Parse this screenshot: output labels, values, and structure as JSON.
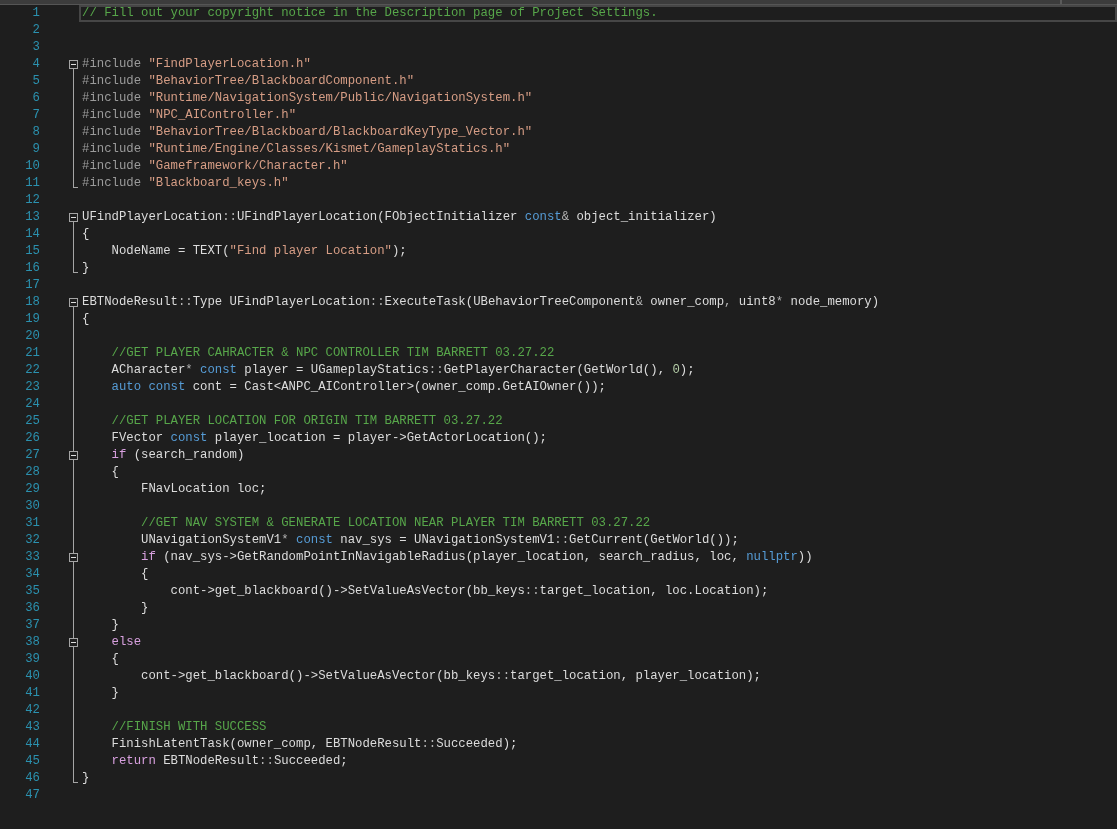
{
  "editor": {
    "lines": [
      {
        "number": "1",
        "current": true,
        "collapsible": false,
        "kind": "plain",
        "tokens": [
          {
            "kind": "comment",
            "text": "// Fill out your copyright notice in the Description page of Project Settings."
          }
        ]
      },
      {
        "number": "2",
        "current": false,
        "collapsible": false,
        "kind": "plain"
      },
      {
        "number": "3",
        "current": false,
        "collapsible": false,
        "kind": "plain"
      },
      {
        "number": "4",
        "current": false,
        "collapsible": true,
        "kind": "fold-start",
        "tokens": [
          {
            "kind": "directive",
            "text": "#include"
          },
          {
            "kind": "string",
            "text": " \"FindPlayerLocation.h\""
          }
        ]
      },
      {
        "number": "5",
        "current": false,
        "collapsible": false,
        "kind": "fold-body",
        "tokens": [
          {
            "kind": "directive",
            "text": "#include"
          },
          {
            "kind": "string",
            "text": " \"BehaviorTree/BlackboardComponent.h\""
          }
        ]
      },
      {
        "number": "6",
        "current": false,
        "collapsible": false,
        "kind": "fold-body",
        "tokens": [
          {
            "kind": "directive",
            "text": "#include"
          },
          {
            "kind": "string",
            "text": " \"Runtime/NavigationSystem/Public/NavigationSystem.h\""
          }
        ]
      },
      {
        "number": "7",
        "current": false,
        "collapsible": false,
        "kind": "fold-body",
        "tokens": [
          {
            "kind": "directive",
            "text": "#include"
          },
          {
            "kind": "string",
            "text": " \"NPC_AIController.h\""
          }
        ]
      },
      {
        "number": "8",
        "current": false,
        "collapsible": false,
        "kind": "fold-body",
        "tokens": [
          {
            "kind": "directive",
            "text": "#include"
          },
          {
            "kind": "string",
            "text": " \"BehaviorTree/Blackboard/BlackboardKeyType_Vector.h\""
          }
        ]
      },
      {
        "number": "9",
        "current": false,
        "collapsible": false,
        "kind": "fold-body",
        "tokens": [
          {
            "kind": "directive",
            "text": "#include"
          },
          {
            "kind": "string",
            "text": " \"Runtime/Engine/Classes/Kismet/GameplayStatics.h\""
          }
        ]
      },
      {
        "number": "10",
        "current": false,
        "collapsible": false,
        "kind": "fold-body",
        "tokens": [
          {
            "kind": "directive",
            "text": "#include"
          },
          {
            "kind": "string",
            "text": " \"Gameframework/Character.h\""
          }
        ]
      },
      {
        "number": "11",
        "current": false,
        "collapsible": false,
        "kind": "fold-end",
        "tokens": [
          {
            "kind": "directive",
            "text": "#include"
          },
          {
            "kind": "string",
            "text": " \"Blackboard_keys.h\""
          }
        ]
      },
      {
        "number": "12",
        "current": false,
        "collapsible": false,
        "kind": "plain"
      },
      {
        "number": "13",
        "current": false,
        "collapsible": true,
        "kind": "fold-start",
        "tokens": [
          {
            "kind": "plain",
            "text": "UFindPlayerLocation"
          },
          {
            "kind": "operator",
            "text": "::"
          },
          {
            "kind": "plain",
            "text": "UFindPlayerLocation(FObjectInitializer "
          },
          {
            "kind": "keyword",
            "text": "const"
          },
          {
            "kind": "operator",
            "text": "&"
          },
          {
            "kind": "plain",
            "text": " object_initializer)"
          }
        ]
      },
      {
        "number": "14",
        "current": false,
        "collapsible": false,
        "kind": "fold-body",
        "tokens": [
          {
            "kind": "plain",
            "text": "{"
          }
        ]
      },
      {
        "number": "15",
        "current": false,
        "collapsible": false,
        "kind": "fold-body",
        "tokens": [
          {
            "kind": "plain",
            "text": "    NodeName = TEXT("
          },
          {
            "kind": "string",
            "text": "\"Find player Location\""
          },
          {
            "kind": "plain",
            "text": ");"
          }
        ]
      },
      {
        "number": "16",
        "current": false,
        "collapsible": false,
        "kind": "fold-end",
        "tokens": [
          {
            "kind": "plain",
            "text": "}"
          }
        ]
      },
      {
        "number": "17",
        "current": false,
        "collapsible": false,
        "kind": "plain"
      },
      {
        "number": "18",
        "current": false,
        "collapsible": true,
        "kind": "fold-start",
        "tokens": [
          {
            "kind": "plain",
            "text": "EBTNodeResult"
          },
          {
            "kind": "operator",
            "text": "::"
          },
          {
            "kind": "plain",
            "text": "Type UFindPlayerLocation"
          },
          {
            "kind": "operator",
            "text": "::"
          },
          {
            "kind": "plain",
            "text": "ExecuteTask(UBehaviorTreeComponent"
          },
          {
            "kind": "operator",
            "text": "&"
          },
          {
            "kind": "plain",
            "text": " owner_comp"
          },
          {
            "kind": "operator",
            "text": ","
          },
          {
            "kind": "plain",
            "text": " uint8"
          },
          {
            "kind": "operator",
            "text": "*"
          },
          {
            "kind": "plain",
            "text": " node_memory)"
          }
        ]
      },
      {
        "number": "19",
        "current": false,
        "collapsible": false,
        "kind": "fold-body",
        "tokens": [
          {
            "kind": "plain",
            "text": "{"
          }
        ]
      },
      {
        "number": "20",
        "current": false,
        "collapsible": false,
        "kind": "fold-body"
      },
      {
        "number": "21",
        "current": false,
        "collapsible": false,
        "kind": "fold-body",
        "tokens": [
          {
            "kind": "comment",
            "text": "    //GET PLAYER CAHRACTER & NPC CONTROLLER TIM BARRETT 03.27.22"
          }
        ]
      },
      {
        "number": "22",
        "current": false,
        "collapsible": false,
        "kind": "fold-body",
        "tokens": [
          {
            "kind": "plain",
            "text": "    ACharacter"
          },
          {
            "kind": "operator",
            "text": "*"
          },
          {
            "kind": "keyword",
            "text": " const"
          },
          {
            "kind": "plain",
            "text": " player = UGameplayStatics"
          },
          {
            "kind": "operator",
            "text": "::"
          },
          {
            "kind": "plain",
            "text": "GetPlayerCharacter(GetWorld(), "
          },
          {
            "kind": "number",
            "text": "0"
          },
          {
            "kind": "plain",
            "text": ");"
          }
        ]
      },
      {
        "number": "23",
        "current": false,
        "collapsible": false,
        "kind": "fold-body",
        "tokens": [
          {
            "kind": "keyword",
            "text": "    auto const"
          },
          {
            "kind": "plain",
            "text": " cont = Cast<ANPC_AIController>(owner_comp.GetAIOwner());"
          }
        ]
      },
      {
        "number": "24",
        "current": false,
        "collapsible": false,
        "kind": "fold-body"
      },
      {
        "number": "25",
        "current": false,
        "collapsible": false,
        "kind": "fold-body",
        "tokens": [
          {
            "kind": "comment",
            "text": "    //GET PLAYER LOCATION FOR ORIGIN TIM BARRETT 03.27.22"
          }
        ]
      },
      {
        "number": "26",
        "current": false,
        "collapsible": false,
        "kind": "fold-body",
        "tokens": [
          {
            "kind": "plain",
            "text": "    FVector "
          },
          {
            "kind": "keyword",
            "text": "const"
          },
          {
            "kind": "plain",
            "text": " player_location = player->GetActorLocation();"
          }
        ]
      },
      {
        "number": "27",
        "current": false,
        "collapsible": true,
        "kind": "fold-body",
        "tokens": [
          {
            "kind": "control",
            "text": "    if"
          },
          {
            "kind": "plain",
            "text": " (search_random)"
          }
        ]
      },
      {
        "number": "28",
        "current": false,
        "collapsible": false,
        "kind": "fold-body",
        "tokens": [
          {
            "kind": "plain",
            "text": "    {"
          }
        ]
      },
      {
        "number": "29",
        "current": false,
        "collapsible": false,
        "kind": "fold-body",
        "tokens": [
          {
            "kind": "plain",
            "text": "        FNavLocation loc;"
          }
        ]
      },
      {
        "number": "30",
        "current": false,
        "collapsible": false,
        "kind": "fold-body"
      },
      {
        "number": "31",
        "current": false,
        "collapsible": false,
        "kind": "fold-body",
        "tokens": [
          {
            "kind": "comment",
            "text": "        //GET NAV SYSTEM & GENERATE LOCATION NEAR PLAYER TIM BARRETT 03.27.22"
          }
        ]
      },
      {
        "number": "32",
        "current": false,
        "collapsible": false,
        "kind": "fold-body",
        "tokens": [
          {
            "kind": "plain",
            "text": "        UNavigationSystemV1"
          },
          {
            "kind": "operator",
            "text": "*"
          },
          {
            "kind": "keyword",
            "text": " const"
          },
          {
            "kind": "plain",
            "text": " nav_sys = UNavigationSystemV1"
          },
          {
            "kind": "operator",
            "text": "::"
          },
          {
            "kind": "plain",
            "text": "GetCurrent(GetWorld());"
          }
        ]
      },
      {
        "number": "33",
        "current": false,
        "collapsible": true,
        "kind": "fold-body",
        "tokens": [
          {
            "kind": "control",
            "text": "        if"
          },
          {
            "kind": "plain",
            "text": " (nav_sys->GetRandomPointInNavigableRadius(player_location, search_radius, loc, "
          },
          {
            "kind": "keyword",
            "text": "nullptr"
          },
          {
            "kind": "plain",
            "text": "))"
          }
        ]
      },
      {
        "number": "34",
        "current": false,
        "collapsible": false,
        "kind": "fold-body",
        "tokens": [
          {
            "kind": "plain",
            "text": "        {"
          }
        ]
      },
      {
        "number": "35",
        "current": false,
        "collapsible": false,
        "kind": "fold-body",
        "tokens": [
          {
            "kind": "plain",
            "text": "            cont->get_blackboard()->SetValueAsVector(bb_keys"
          },
          {
            "kind": "operator",
            "text": "::"
          },
          {
            "kind": "plain",
            "text": "target_location, loc.Location);"
          }
        ]
      },
      {
        "number": "36",
        "current": false,
        "collapsible": false,
        "kind": "fold-body",
        "tokens": [
          {
            "kind": "plain",
            "text": "        }"
          }
        ]
      },
      {
        "number": "37",
        "current": false,
        "collapsible": false,
        "kind": "fold-body",
        "tokens": [
          {
            "kind": "plain",
            "text": "    }"
          }
        ]
      },
      {
        "number": "38",
        "current": false,
        "collapsible": true,
        "kind": "fold-body",
        "tokens": [
          {
            "kind": "control",
            "text": "    else"
          }
        ]
      },
      {
        "number": "39",
        "current": false,
        "collapsible": false,
        "kind": "fold-body",
        "tokens": [
          {
            "kind": "plain",
            "text": "    {"
          }
        ]
      },
      {
        "number": "40",
        "current": false,
        "collapsible": false,
        "kind": "fold-body",
        "tokens": [
          {
            "kind": "plain",
            "text": "        cont->get_blackboard()->SetValueAsVector(bb_keys"
          },
          {
            "kind": "operator",
            "text": "::"
          },
          {
            "kind": "plain",
            "text": "target_location, player_location);"
          }
        ]
      },
      {
        "number": "41",
        "current": false,
        "collapsible": false,
        "kind": "fold-body",
        "tokens": [
          {
            "kind": "plain",
            "text": "    }"
          }
        ]
      },
      {
        "number": "42",
        "current": false,
        "collapsible": false,
        "kind": "fold-body"
      },
      {
        "number": "43",
        "current": false,
        "collapsible": false,
        "kind": "fold-body",
        "tokens": [
          {
            "kind": "comment",
            "text": "    //FINISH WITH SUCCESS"
          }
        ]
      },
      {
        "number": "44",
        "current": false,
        "collapsible": false,
        "kind": "fold-body",
        "tokens": [
          {
            "kind": "plain",
            "text": "    FinishLatentTask(owner_comp, EBTNodeResult"
          },
          {
            "kind": "operator",
            "text": "::"
          },
          {
            "kind": "plain",
            "text": "Succeeded);"
          }
        ]
      },
      {
        "number": "45",
        "current": false,
        "collapsible": false,
        "kind": "fold-body",
        "tokens": [
          {
            "kind": "control",
            "text": "    return"
          },
          {
            "kind": "plain",
            "text": " EBTNodeResult"
          },
          {
            "kind": "operator",
            "text": "::"
          },
          {
            "kind": "plain",
            "text": "Succeeded;"
          }
        ]
      },
      {
        "number": "46",
        "current": false,
        "collapsible": false,
        "kind": "fold-end",
        "tokens": [
          {
            "kind": "plain",
            "text": "}"
          }
        ]
      },
      {
        "number": "47",
        "current": false,
        "collapsible": false,
        "kind": "plain"
      }
    ]
  }
}
